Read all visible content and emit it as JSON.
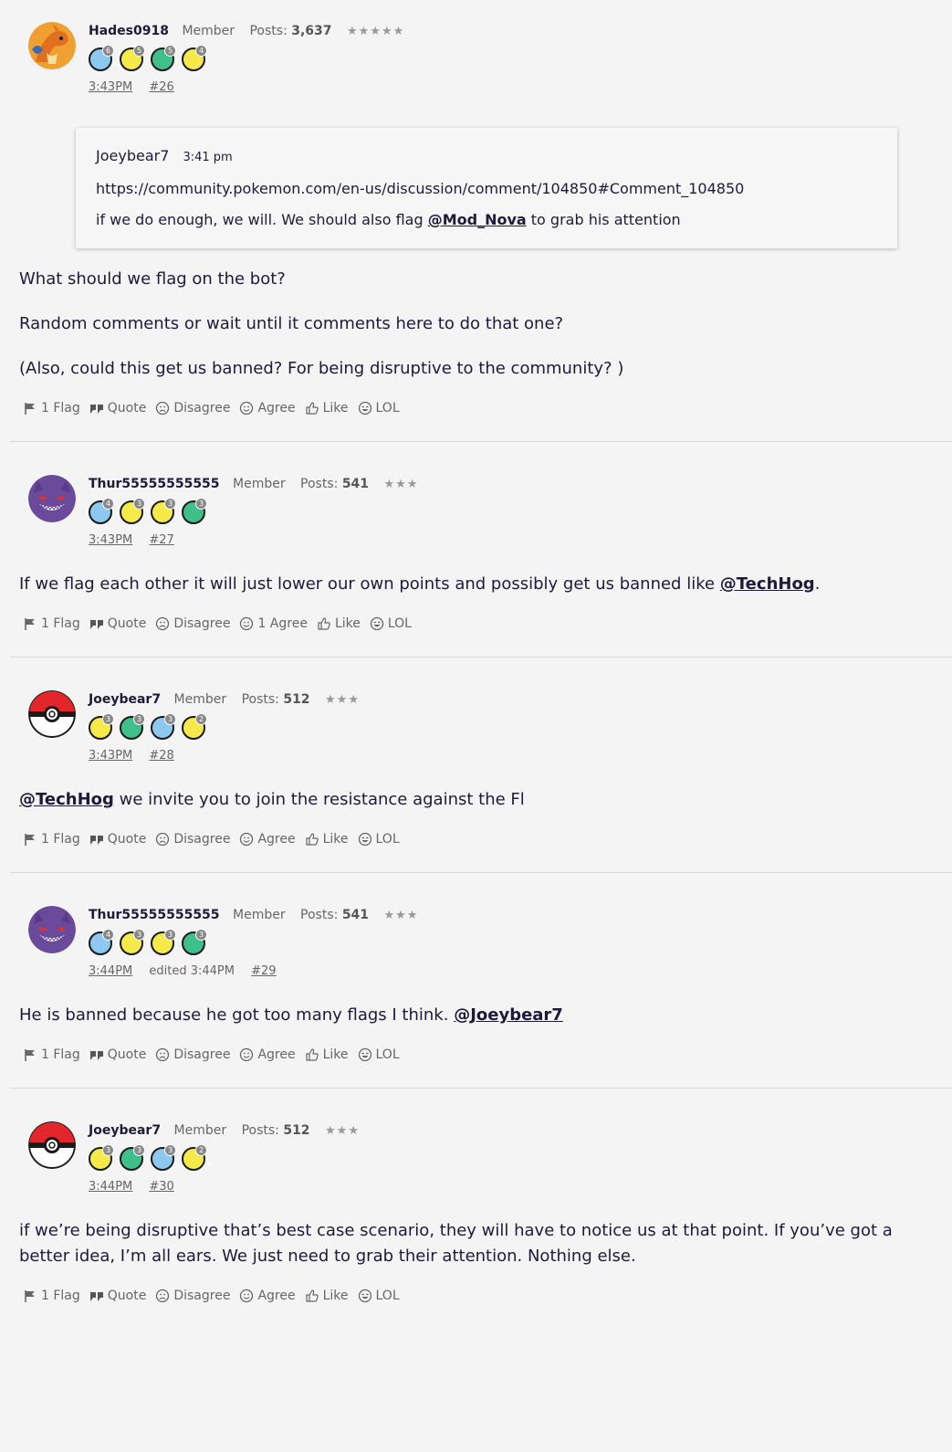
{
  "posts": [
    {
      "username": "Hades0918",
      "role": "Member",
      "posts_label": "Posts:",
      "posts_count": "3,637",
      "stars": "★★★★★",
      "badges": [
        {
          "color": "blue",
          "num": "6"
        },
        {
          "color": "yellow",
          "num": "5"
        },
        {
          "color": "green",
          "num": "5"
        },
        {
          "color": "yellow",
          "num": "4"
        }
      ],
      "time": "3:43PM",
      "edited": "",
      "number": "#26",
      "quote": {
        "author": "Joeybear7",
        "time": "3:41 pm",
        "link": "https://community.pokemon.com/en-us/discussion/comment/104850#Comment_104850",
        "text_before": "if we do enough, we will. We should also flag ",
        "mention": "@Mod_Nova",
        "text_after": " to grab his attention"
      },
      "paragraphs": [
        "What should we flag on the bot?",
        "Random comments or wait until it comments here to do that one?",
        "(Also, could this get us banned? For being disruptive to the community? )"
      ],
      "reactions": {
        "flag": "1 Flag",
        "quote": "Quote",
        "disagree": "Disagree",
        "agree": "Agree",
        "like": "Like",
        "lol": "LOL"
      }
    },
    {
      "username": "Thur55555555555",
      "role": "Member",
      "posts_label": "Posts:",
      "posts_count": "541",
      "stars": "★★★",
      "badges": [
        {
          "color": "blue",
          "num": "4"
        },
        {
          "color": "yellow",
          "num": "3"
        },
        {
          "color": "yellow",
          "num": "3"
        },
        {
          "color": "green",
          "num": "3"
        }
      ],
      "time": "3:43PM",
      "edited": "",
      "number": "#27",
      "body_before": "If we flag each other it will just lower our own points and possibly get us banned like ",
      "body_mention": "@TechHog",
      "body_after": ".",
      "reactions": {
        "flag": "1 Flag",
        "quote": "Quote",
        "disagree": "Disagree",
        "agree": "1 Agree",
        "like": "Like",
        "lol": "LOL"
      }
    },
    {
      "username": "Joeybear7",
      "role": "Member",
      "posts_label": "Posts:",
      "posts_count": "512",
      "stars": "★★★",
      "badges": [
        {
          "color": "yellow",
          "num": "3"
        },
        {
          "color": "green",
          "num": "3"
        },
        {
          "color": "blue",
          "num": "3"
        },
        {
          "color": "yellow",
          "num": "2"
        }
      ],
      "time": "3:43PM",
      "edited": "",
      "number": "#28",
      "body_mention_first": "@TechHog",
      "body_after": " we invite you to join the resistance against the Fl",
      "reactions": {
        "flag": "1 Flag",
        "quote": "Quote",
        "disagree": "Disagree",
        "agree": "Agree",
        "like": "Like",
        "lol": "LOL"
      }
    },
    {
      "username": "Thur55555555555",
      "role": "Member",
      "posts_label": "Posts:",
      "posts_count": "541",
      "stars": "★★★",
      "badges": [
        {
          "color": "blue",
          "num": "4"
        },
        {
          "color": "yellow",
          "num": "3"
        },
        {
          "color": "yellow",
          "num": "3"
        },
        {
          "color": "green",
          "num": "3"
        }
      ],
      "time": "3:44PM",
      "edited": "edited 3:44PM",
      "number": "#29",
      "body_before": "He is banned because he got too many flags I think. ",
      "body_mention": "@Joeybear7",
      "body_after": "",
      "reactions": {
        "flag": "1 Flag",
        "quote": "Quote",
        "disagree": "Disagree",
        "agree": "Agree",
        "like": "Like",
        "lol": "LOL"
      }
    },
    {
      "username": "Joeybear7",
      "role": "Member",
      "posts_label": "Posts:",
      "posts_count": "512",
      "stars": "★★★",
      "badges": [
        {
          "color": "yellow",
          "num": "3"
        },
        {
          "color": "green",
          "num": "3"
        },
        {
          "color": "blue",
          "num": "3"
        },
        {
          "color": "yellow",
          "num": "2"
        }
      ],
      "time": "3:44PM",
      "edited": "",
      "number": "#30",
      "paragraphs": [
        "if we’re being disruptive that’s best case scenario, they will have to notice us at that point. If you’ve got a better idea, I’m all ears. We just need to grab their attention. Nothing else."
      ],
      "reactions": {
        "flag": "1 Flag",
        "quote": "Quote",
        "disagree": "Disagree",
        "agree": "Agree",
        "like": "Like",
        "lol": "LOL"
      }
    }
  ],
  "avatars": [
    "charizard-avatar",
    "gengar-avatar",
    "pokeball-avatar",
    "gengar-avatar",
    "pokeball-avatar"
  ]
}
